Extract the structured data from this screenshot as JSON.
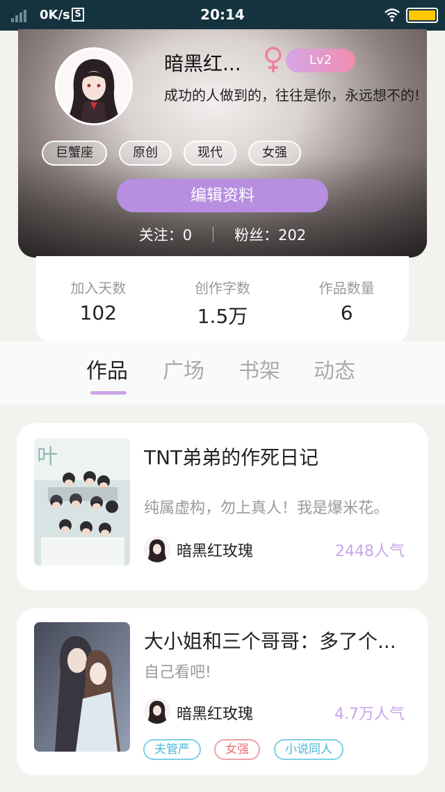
{
  "status_bar": {
    "speed": "0K/s",
    "s_badge": "S",
    "time": "20:14"
  },
  "profile": {
    "nickname": "暗黑红...",
    "level": "Lv2",
    "bio": "成功的人做到的，往往是你，永远想不的!",
    "tags": [
      "巨蟹座",
      "原创",
      "现代",
      "女强"
    ],
    "edit_button": "编辑资料",
    "following": "关注：0",
    "followers": "粉丝：202"
  },
  "stats": [
    {
      "label": "加入天数",
      "value": "102"
    },
    {
      "label": "创作字数",
      "value": "1.5万"
    },
    {
      "label": "作品数量",
      "value": "6"
    }
  ],
  "tabs": [
    "作品",
    "广场",
    "书架",
    "动态"
  ],
  "works": [
    {
      "title": "TNT弟弟的作死日记",
      "desc": "纯属虚构，勿上真人！我是爆米花。",
      "author": "暗黑红玫瑰",
      "popularity": "2448人气",
      "tags": []
    },
    {
      "title": "大小姐和三个哥哥：多了个...",
      "desc": "自己看吧!",
      "author": "暗黑红玫瑰",
      "popularity": "4.7万人气",
      "tags": [
        "夫管严",
        "女强",
        "小说同人"
      ]
    }
  ],
  "colors": {
    "accent": "#b78ee0",
    "status_bar": "#15333f",
    "popularity": "#c9a5e8"
  }
}
